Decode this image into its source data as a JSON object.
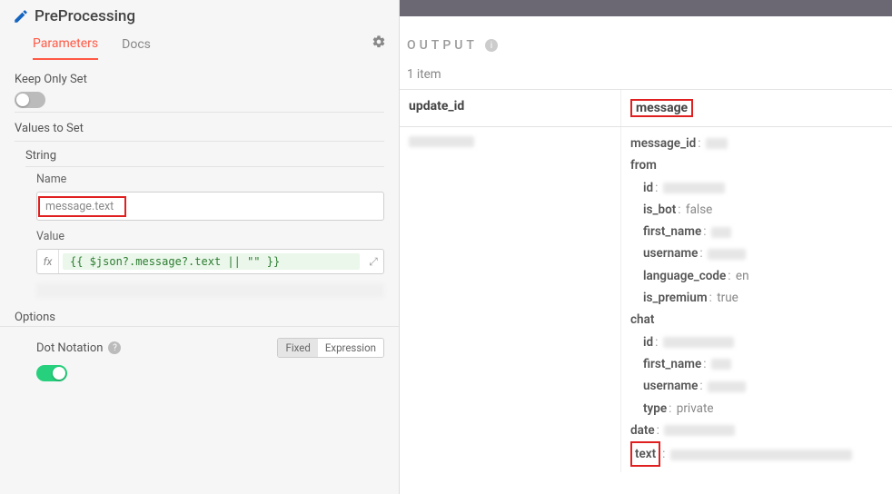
{
  "header": {
    "title": "PreProcessing"
  },
  "tabs": {
    "parameters": "Parameters",
    "docs": "Docs"
  },
  "fields": {
    "keep_only_set": "Keep Only Set",
    "values_to_set": "Values to Set",
    "string": "String",
    "name_label": "Name",
    "name_value": "message.text",
    "value_label": "Value",
    "value_expr": "{{ $json?.message?.text || \"\" }}",
    "options": "Options",
    "dot_notation": "Dot Notation",
    "fixed": "Fixed",
    "expression": "Expression"
  },
  "output": {
    "title": "OUTPUT",
    "count": "1 item",
    "columns": {
      "update_id": "update_id",
      "message": "message"
    },
    "entry": {
      "message_id_key": "message_id",
      "from_key": "from",
      "from": {
        "id_key": "id",
        "is_bot_key": "is_bot",
        "is_bot_val": "false",
        "first_name_key": "first_name",
        "username_key": "username",
        "language_code_key": "language_code",
        "language_code_val": "en",
        "is_premium_key": "is_premium",
        "is_premium_val": "true"
      },
      "chat_key": "chat",
      "chat": {
        "id_key": "id",
        "first_name_key": "first_name",
        "username_key": "username",
        "type_key": "type",
        "type_val": "private"
      },
      "date_key": "date",
      "text_key": "text"
    }
  }
}
